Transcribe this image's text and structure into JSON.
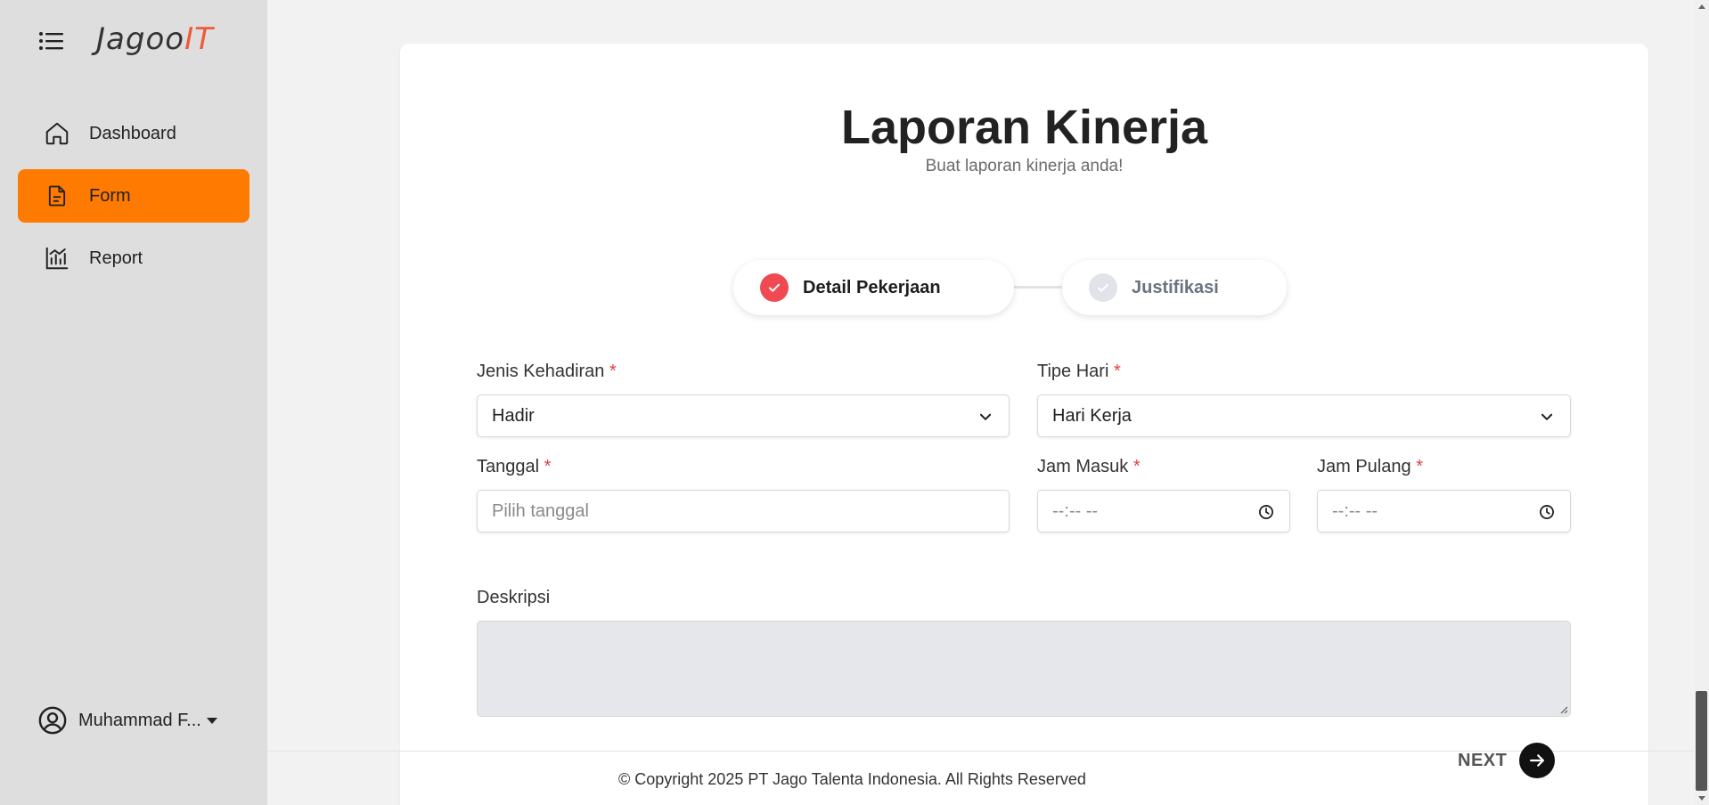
{
  "sidebar": {
    "logo_main": "Jagoo",
    "logo_accent": "IT",
    "items": [
      {
        "label": "Dashboard",
        "icon": "home-icon",
        "active": false
      },
      {
        "label": "Form",
        "icon": "document-icon",
        "active": true
      },
      {
        "label": "Report",
        "icon": "chart-icon",
        "active": false
      }
    ],
    "user_name": "Muhammad F..."
  },
  "page": {
    "title": "Laporan Kinerja",
    "subtitle": "Buat laporan kinerja anda!"
  },
  "stepper": [
    {
      "label": "Detail Pekerjaan",
      "state": "active"
    },
    {
      "label": "Justifikasi",
      "state": "inactive"
    }
  ],
  "form": {
    "jenis_kehadiran": {
      "label": "Jenis Kehadiran",
      "required": "*",
      "value": "Hadir"
    },
    "tipe_hari": {
      "label": "Tipe Hari",
      "required": "*",
      "value": "Hari Kerja"
    },
    "tanggal": {
      "label": "Tanggal",
      "required": "*",
      "placeholder": "Pilih tanggal"
    },
    "jam_masuk": {
      "label": "Jam Masuk",
      "required": "*",
      "placeholder": "--:-- --"
    },
    "jam_pulang": {
      "label": "Jam Pulang",
      "required": "*",
      "placeholder": "--:-- --"
    },
    "deskripsi": {
      "label": "Deskripsi",
      "value": ""
    }
  },
  "actions": {
    "next_label": "NEXT"
  },
  "footer": {
    "copyright": "© Copyright 2025 PT Jago Talenta Indonesia. All Rights Reserved"
  },
  "colors": {
    "accent": "#ff7a00",
    "step_active": "#ef4a52",
    "sidebar_bg": "#dedede",
    "required": "#e04040"
  }
}
